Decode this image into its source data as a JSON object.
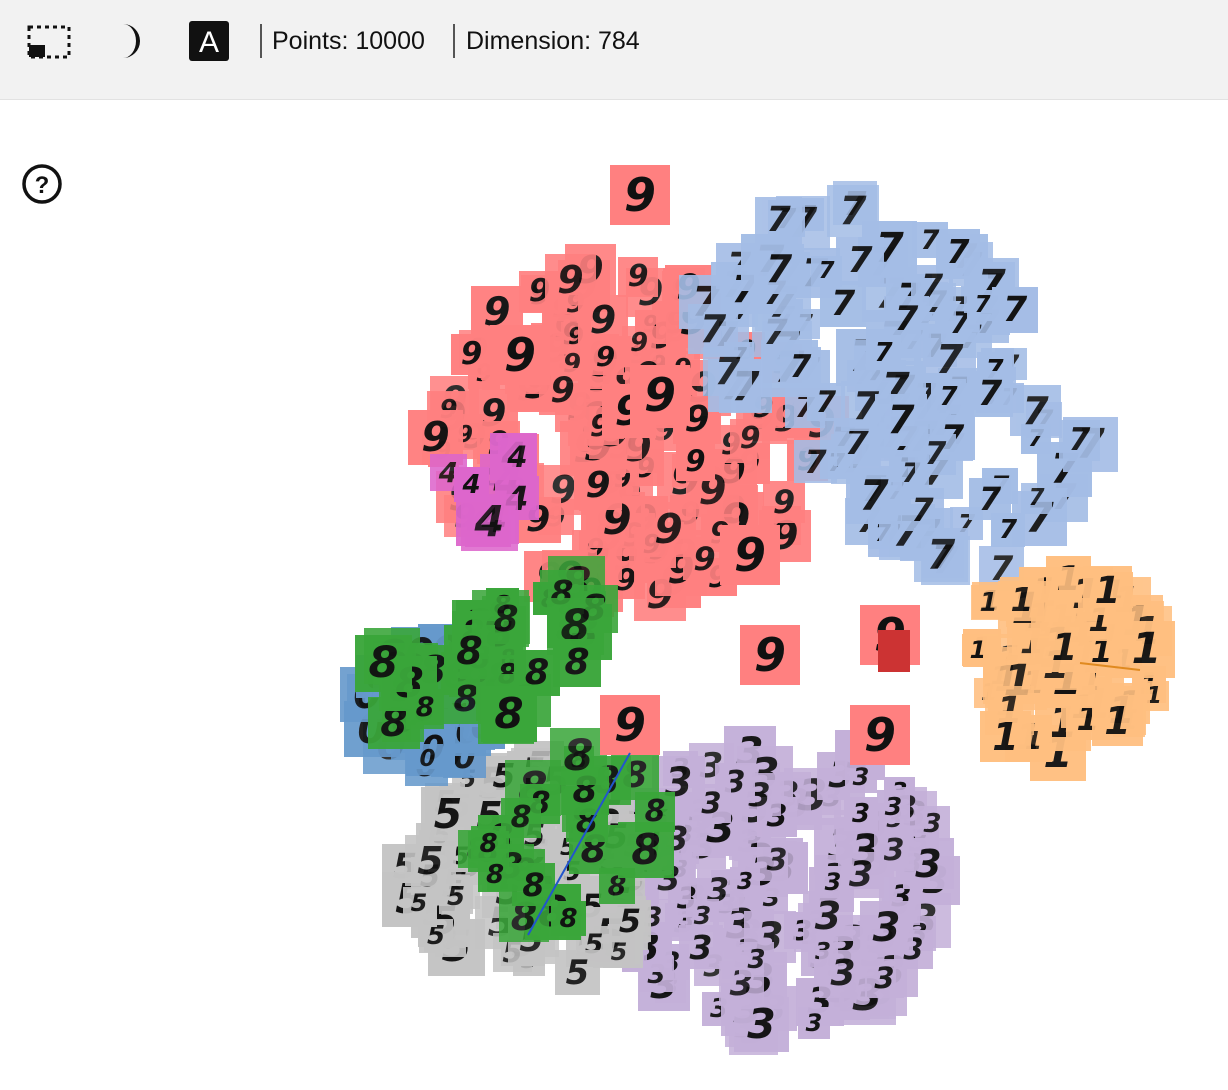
{
  "toolbar": {
    "select_tool_icon": "selection-rectangle-icon",
    "night_mode_icon": "moon-icon",
    "label_toggle_icon": "label-text-icon",
    "label_toggle_glyph": "A",
    "points_text": "Points: 10000",
    "dimension_text": "Dimension: 784"
  },
  "help": {
    "icon": "question-circle-icon",
    "glyph": "?"
  },
  "colors": {
    "digit_9": "#ff8080",
    "digit_7": "#a4bde6",
    "digit_1": "#ffbf80",
    "digit_3": "#c4b0d9",
    "digit_5": "#c4c4c4",
    "digit_8": "#3aa63a",
    "digit_0": "#6699cc",
    "digit_4": "#dd66cc",
    "digit_2": "#cc3333"
  }
}
